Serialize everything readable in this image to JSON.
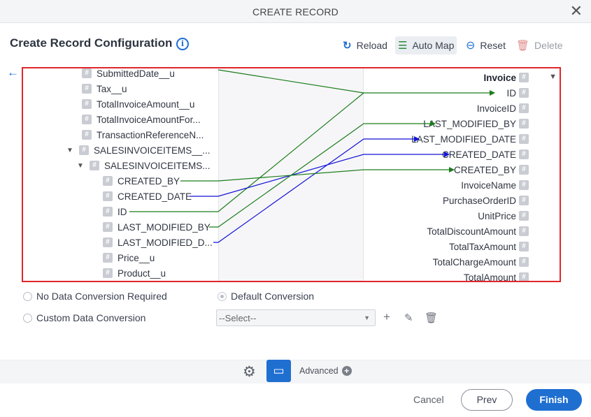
{
  "dialog": {
    "title": "CREATE RECORD"
  },
  "header": {
    "title": "Create Record Configuration"
  },
  "toolbar": {
    "reload": "Reload",
    "auto_map": "Auto Map",
    "reset": "Reset",
    "delete": "Delete"
  },
  "mapper": {
    "left_items": {
      "submitted_date": "SubmittedDate__u",
      "tax": "Tax__u",
      "total_invoice_amount": "TotalInvoiceAmount__u",
      "total_invoice_amount_for": "TotalInvoiceAmountFor...",
      "transaction_reference": "TransactionReferenceN...",
      "sales_invoice_items_1": "SALESINVOICEITEMS__...",
      "sales_invoice_items_2": "SALESINVOICEITEMS...",
      "created_by": "CREATED_BY",
      "created_date": "CREATED_DATE",
      "id": "ID",
      "last_modified_by": "LAST_MODIFIED_BY",
      "last_modified_date": "LAST_MODIFIED_D...",
      "price": "Price__u",
      "product": "Product__u"
    },
    "right_items": {
      "invoice": "Invoice",
      "id": "ID",
      "invoice_id": "InvoiceID",
      "last_modified_by": "LAST_MODIFIED_BY",
      "last_modified_date": "LAST_MODIFIED_DATE",
      "created_date": "CREATED_DATE",
      "created_by": "CREATED_BY",
      "invoice_name": "InvoiceName",
      "purchase_order_id": "PurchaseOrderID",
      "unit_price": "UnitPrice",
      "total_discount_amount": "TotalDiscountAmount",
      "total_tax_amount": "TotalTaxAmount",
      "total_charge_amount": "TotalChargeAmount",
      "total_amount": "TotalAmount"
    },
    "colors": {
      "green": "#1a7d1a",
      "blue": "#1212d6"
    }
  },
  "options": {
    "no_conversion": "No Data Conversion Required",
    "default_conversion": "Default Conversion",
    "custom_conversion": "Custom Data Conversion",
    "select_placeholder": "--Select--"
  },
  "footer": {
    "advanced": "Advanced",
    "cancel": "Cancel",
    "prev": "Prev",
    "finish": "Finish"
  }
}
